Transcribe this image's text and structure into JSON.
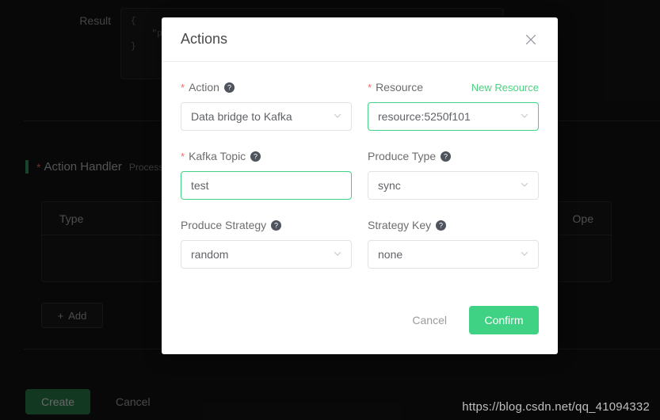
{
  "background": {
    "result_label": "Result",
    "result_code": "{\n    \"payload\": \"\"\n}",
    "section": {
      "required_mark": "*",
      "title": "Action Handler",
      "subtitle": "Process"
    },
    "table": {
      "columns": [
        "Type",
        "Ope"
      ]
    },
    "add_button": {
      "icon": "plus-icon",
      "label": "Add"
    },
    "create_button": "Create",
    "cancel_button": "Cancel",
    "watermark": "https://blog.csdn.net/qq_41094332"
  },
  "modal": {
    "title": "Actions",
    "close_icon": "close-icon",
    "fields": {
      "action": {
        "required_mark": "*",
        "label": "Action",
        "help_icon": "question-circle-icon",
        "value": "Data bridge to Kafka",
        "chevron_icon": "chevron-down-icon",
        "focused": false
      },
      "resource": {
        "required_mark": "*",
        "label": "Resource",
        "link_label": "New Resource",
        "value": "resource:5250f101",
        "chevron_icon": "chevron-down-icon",
        "focused": true
      },
      "kafka_topic": {
        "required_mark": "*",
        "label": "Kafka Topic",
        "help_icon": "question-circle-icon",
        "value": "test",
        "placeholder": "",
        "focused": true
      },
      "produce_type": {
        "label": "Produce Type",
        "help_icon": "question-circle-icon",
        "value": "sync",
        "chevron_icon": "chevron-down-icon",
        "focused": false
      },
      "produce_strategy": {
        "label": "Produce Strategy",
        "help_icon": "question-circle-icon",
        "value": "random",
        "chevron_icon": "chevron-down-icon",
        "focused": false
      },
      "strategy_key": {
        "label": "Strategy Key",
        "help_icon": "question-circle-icon",
        "value": "none",
        "chevron_icon": "chevron-down-icon",
        "focused": false
      }
    },
    "footer": {
      "cancel_label": "Cancel",
      "confirm_label": "Confirm"
    }
  },
  "colors": {
    "accent_green": "#3fd184",
    "link_green": "#4ad27f",
    "required_red": "#f56c6c",
    "modal_bg": "#ffffff",
    "page_bg": "#101010"
  }
}
